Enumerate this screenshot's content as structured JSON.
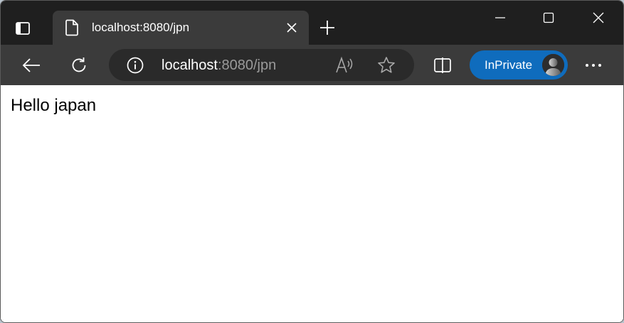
{
  "browser": {
    "tab": {
      "title": "localhost:8080/jpn",
      "icon": "document-icon"
    },
    "address": {
      "host": "localhost",
      "rest": ":8080/jpn"
    },
    "inprivate_label": "InPrivate",
    "colors": {
      "titlebar": "#1f1f1f",
      "toolbar": "#3b3b3b",
      "addressbar": "#2a2a2a",
      "inprivate_accent": "#0f6cbd"
    }
  },
  "page": {
    "body_text": "Hello japan"
  }
}
